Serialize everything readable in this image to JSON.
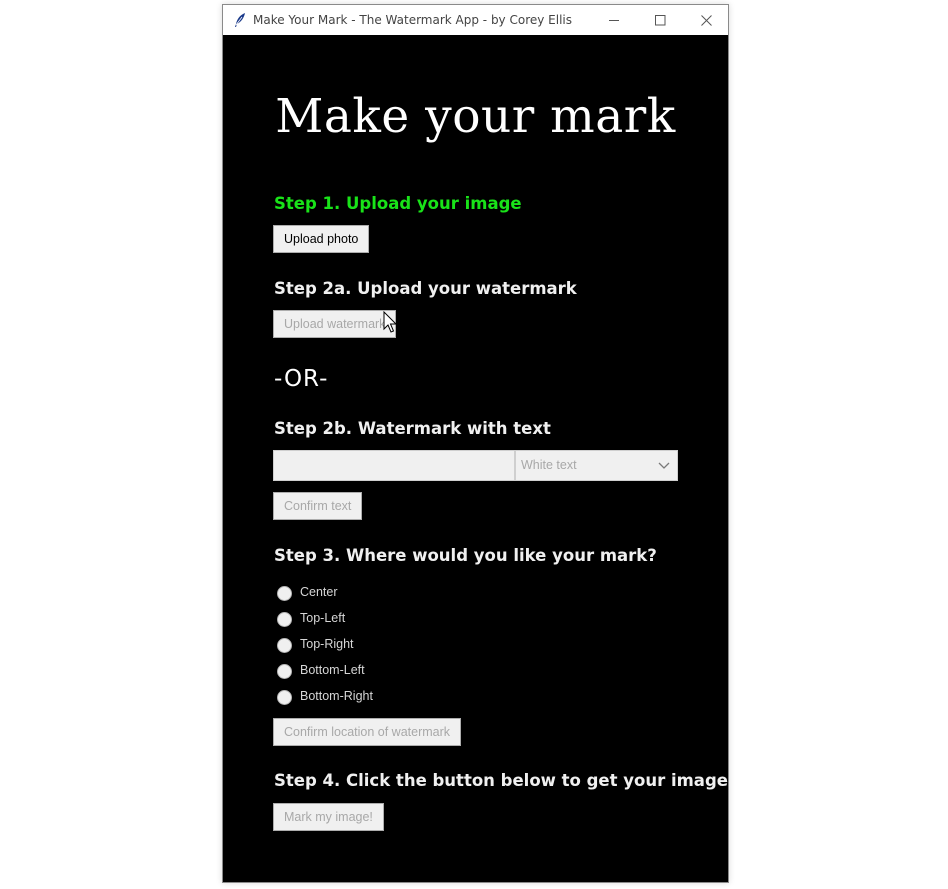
{
  "window": {
    "title": "Make Your Mark - The Watermark App - by Corey Ellis",
    "controls": {
      "minimize_icon": "minimize-icon",
      "maximize_icon": "maximize-icon",
      "close_icon": "close-icon"
    }
  },
  "app": {
    "heading": "Make your mark",
    "step1": {
      "label": "Step 1. Upload your image",
      "button": "Upload photo",
      "color": "#19e319"
    },
    "step2a": {
      "label": "Step 2a. Upload your watermark",
      "button": "Upload watermark"
    },
    "or": "-OR-",
    "step2b": {
      "label": "Step 2b. Watermark with text",
      "text_value": "",
      "color_selected": "White text",
      "button": "Confirm text"
    },
    "step3": {
      "label": "Step 3. Where would you like your mark?",
      "options": [
        "Center",
        "Top-Left",
        "Top-Right",
        "Bottom-Left",
        "Bottom-Right"
      ],
      "button": "Confirm location of watermark"
    },
    "step4": {
      "label": "Step 4. Click the button below to get your image",
      "button": "Mark my image!"
    }
  },
  "colors": {
    "background": "#000000",
    "text": "#ffffff",
    "highlight": "#19e319",
    "disabled_text": "#a8a8a8"
  }
}
